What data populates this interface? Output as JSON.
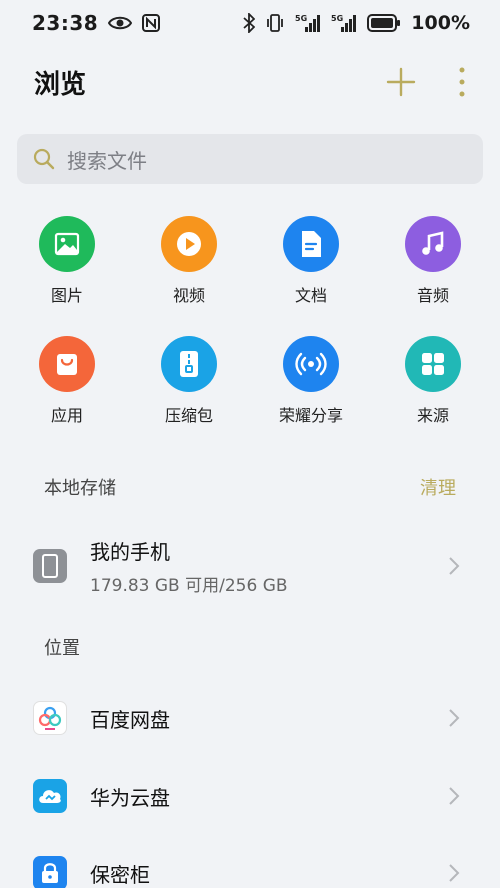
{
  "status_bar": {
    "time": "23:38",
    "battery": "100%",
    "icons": [
      "eye-icon",
      "nfc-icon",
      "bluetooth-icon",
      "vibrate-icon",
      "signal-5g-icon",
      "signal-5g-icon",
      "battery-icon"
    ]
  },
  "header": {
    "title": "浏览",
    "actions": [
      "add-icon",
      "more-icon"
    ],
    "accent_color": "#b9ab5e"
  },
  "search": {
    "placeholder": "搜索文件"
  },
  "categories": [
    {
      "label": "图片",
      "icon": "image-icon",
      "color": "#1fba5b"
    },
    {
      "label": "视频",
      "icon": "play-icon",
      "color": "#f7951d"
    },
    {
      "label": "文档",
      "icon": "document-icon",
      "color": "#1e84ef"
    },
    {
      "label": "音频",
      "icon": "music-icon",
      "color": "#8d5ee0"
    },
    {
      "label": "应用",
      "icon": "shopping-bag-icon",
      "color": "#f4663a"
    },
    {
      "label": "压缩包",
      "icon": "zip-icon",
      "color": "#1aa3e6"
    },
    {
      "label": "荣耀分享",
      "icon": "share-wave-icon",
      "color": "#1e84ef"
    },
    {
      "label": "来源",
      "icon": "grid-icon",
      "color": "#21b8b6"
    }
  ],
  "local_storage": {
    "title": "本地存储",
    "action": "清理",
    "device": {
      "name": "我的手机",
      "usage": "179.83 GB 可用/256 GB",
      "icon": "phone-icon"
    }
  },
  "locations": {
    "title": "位置",
    "items": [
      {
        "label": "百度网盘",
        "icon": "baidu-netdisk-icon"
      },
      {
        "label": "华为云盘",
        "icon": "cloud-icon"
      },
      {
        "label": "保密柜",
        "icon": "lock-icon"
      }
    ]
  }
}
